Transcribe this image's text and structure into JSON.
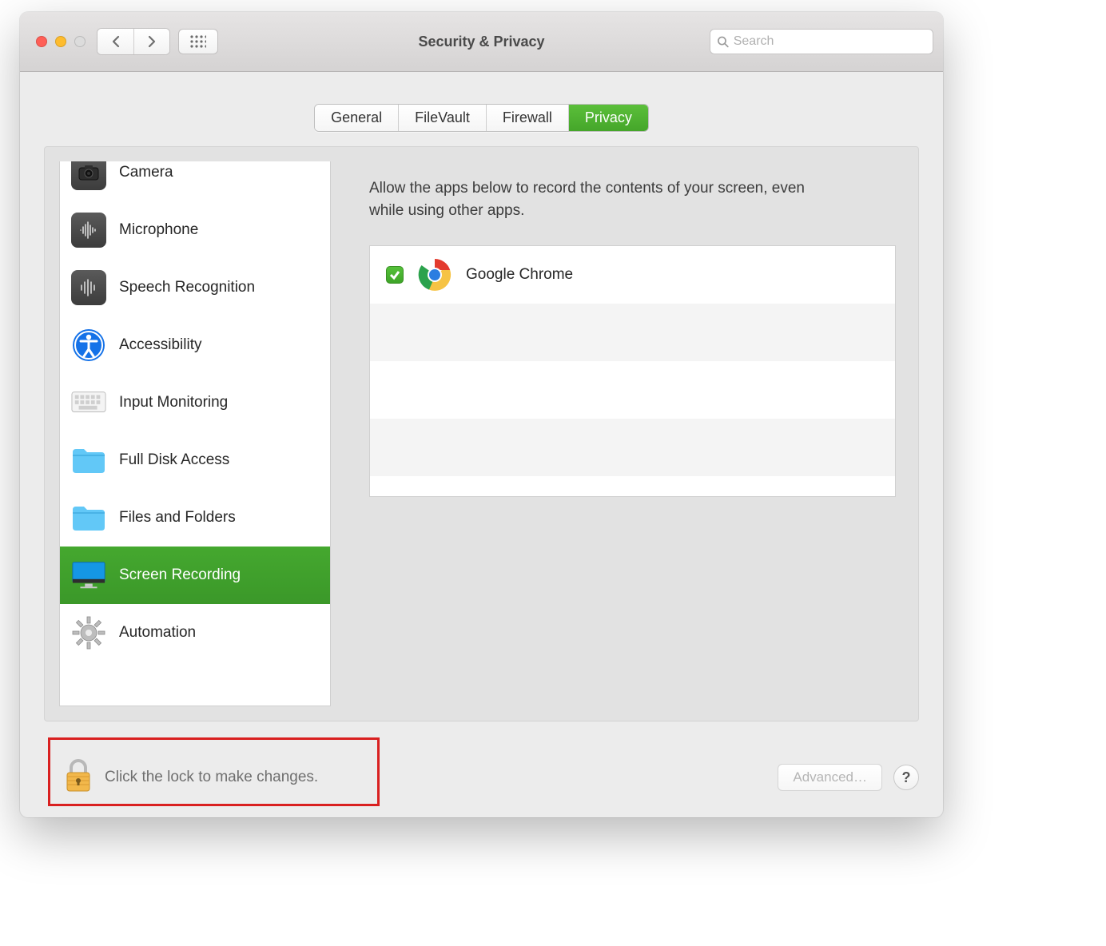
{
  "window": {
    "title": "Security & Privacy"
  },
  "search": {
    "placeholder": "Search"
  },
  "tabs": {
    "items": [
      "General",
      "FileVault",
      "Firewall",
      "Privacy"
    ],
    "active_index": 3
  },
  "sidebar": {
    "items": [
      {
        "label": "Camera",
        "icon": "camera-icon",
        "selected": false
      },
      {
        "label": "Microphone",
        "icon": "microphone-icon",
        "selected": false
      },
      {
        "label": "Speech Recognition",
        "icon": "waveform-icon",
        "selected": false
      },
      {
        "label": "Accessibility",
        "icon": "accessibility-icon",
        "selected": false
      },
      {
        "label": "Input Monitoring",
        "icon": "keyboard-icon",
        "selected": false
      },
      {
        "label": "Full Disk Access",
        "icon": "folder-icon",
        "selected": false
      },
      {
        "label": "Files and Folders",
        "icon": "folder-icon",
        "selected": false
      },
      {
        "label": "Screen Recording",
        "icon": "display-icon",
        "selected": true
      },
      {
        "label": "Automation",
        "icon": "gear-icon",
        "selected": false
      }
    ]
  },
  "main": {
    "description": "Allow the apps below to record the contents of your screen, even while using other apps.",
    "apps": [
      {
        "name": "Google Chrome",
        "checked": true,
        "icon": "chrome-icon"
      }
    ]
  },
  "footer": {
    "lock_text": "Click the lock to make changes.",
    "advanced_label": "Advanced…",
    "help_label": "?"
  }
}
